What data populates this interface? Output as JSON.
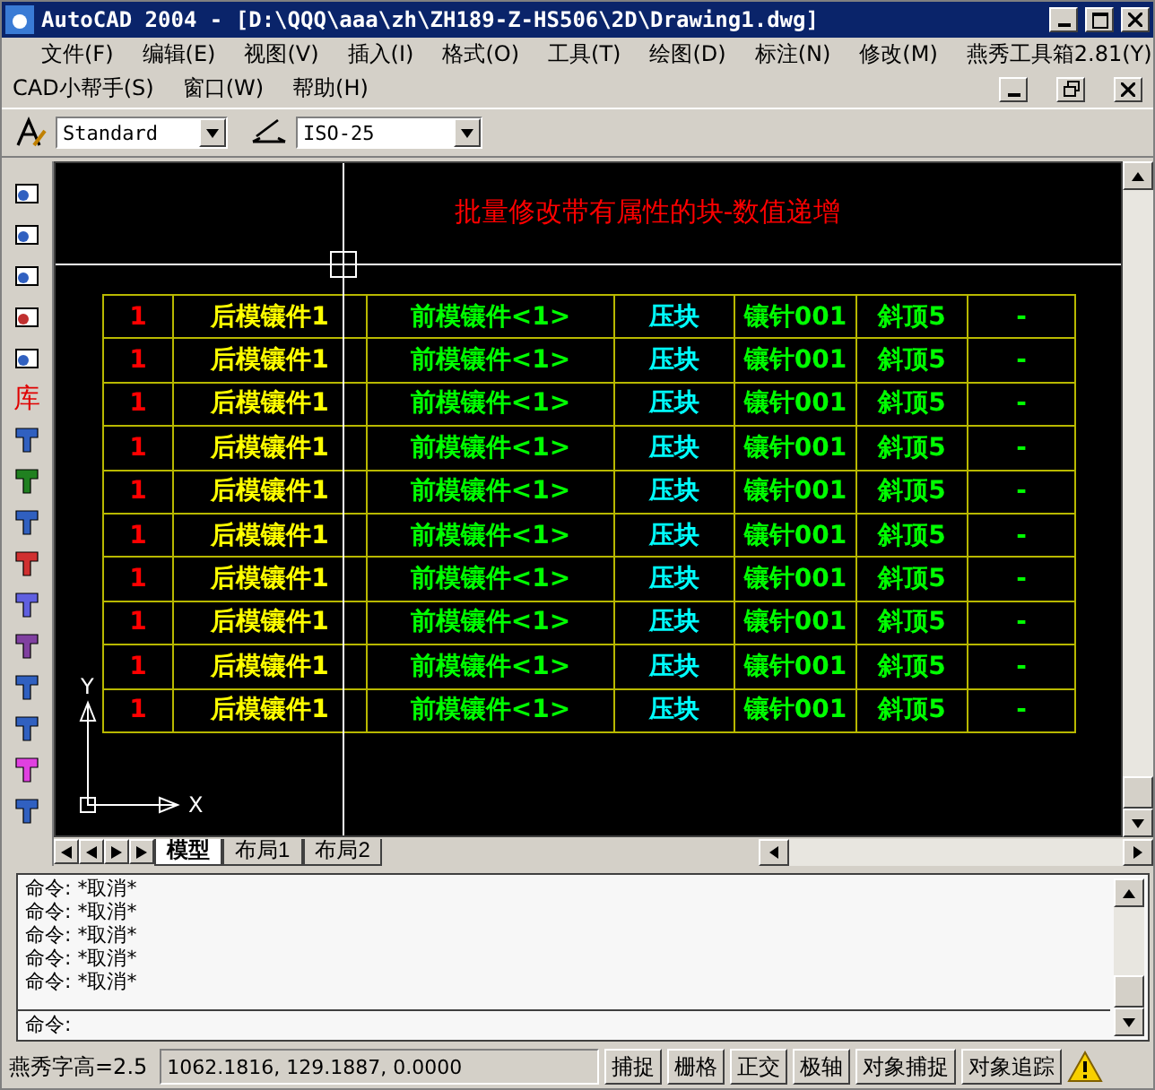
{
  "window": {
    "title": "AutoCAD 2004 - [D:\\QQQ\\aaa\\zh\\ZH189-Z-HS506\\2D\\Drawing1.dwg]"
  },
  "menu": [
    "文件(F)",
    "编辑(E)",
    "视图(V)",
    "插入(I)",
    "格式(O)",
    "工具(T)",
    "绘图(D)",
    "标注(N)",
    "修改(M)",
    "燕秀工具箱2.81(Y)"
  ],
  "menu_row_2": [
    "CAD小帮手(S)",
    "窗口(W)",
    "帮助(H)"
  ],
  "toolbar": {
    "text_style": "Standard",
    "dim_style": "ISO-25"
  },
  "side_toolbar": {
    "library_button": "库"
  },
  "drawing": {
    "title": "批量修改带有属性的块-数值递增",
    "rows": [
      [
        "1",
        "后模镶件1",
        "前模镶件<1>",
        "压块",
        "镶针001",
        "斜顶5",
        "-"
      ],
      [
        "1",
        "后模镶件1",
        "前模镶件<1>",
        "压块",
        "镶针001",
        "斜顶5",
        "-"
      ],
      [
        "1",
        "后模镶件1",
        "前模镶件<1>",
        "压块",
        "镶针001",
        "斜顶5",
        "-"
      ],
      [
        "1",
        "后模镶件1",
        "前模镶件<1>",
        "压块",
        "镶针001",
        "斜顶5",
        "-"
      ],
      [
        "1",
        "后模镶件1",
        "前模镶件<1>",
        "压块",
        "镶针001",
        "斜顶5",
        "-"
      ],
      [
        "1",
        "后模镶件1",
        "前模镶件<1>",
        "压块",
        "镶针001",
        "斜顶5",
        "-"
      ],
      [
        "1",
        "后模镶件1",
        "前模镶件<1>",
        "压块",
        "镶针001",
        "斜顶5",
        "-"
      ],
      [
        "1",
        "后模镶件1",
        "前模镶件<1>",
        "压块",
        "镶针001",
        "斜顶5",
        "-"
      ],
      [
        "1",
        "后模镶件1",
        "前模镶件<1>",
        "压块",
        "镶针001",
        "斜顶5",
        "-"
      ],
      [
        "1",
        "后模镶件1",
        "前模镶件<1>",
        "压块",
        "镶针001",
        "斜顶5",
        "-"
      ]
    ],
    "ucs": {
      "y": "Y",
      "x": "X"
    }
  },
  "layout_tabs": [
    {
      "label": "模型",
      "selected": true
    },
    {
      "label": "布局1",
      "selected": false
    },
    {
      "label": "布局2",
      "selected": false
    }
  ],
  "command": {
    "history": [
      "命令: *取消*",
      "命令: *取消*",
      "命令: *取消*",
      "命令: *取消*",
      "命令: *取消*"
    ],
    "prompt": "命令:"
  },
  "status_bar": {
    "text_height": "燕秀字高=2.5",
    "coordinates": "1062.1816, 129.1887, 0.0000",
    "buttons": [
      "捕捉",
      "栅格",
      "正交",
      "极轴",
      "对象捕捉",
      "对象追踪"
    ]
  }
}
